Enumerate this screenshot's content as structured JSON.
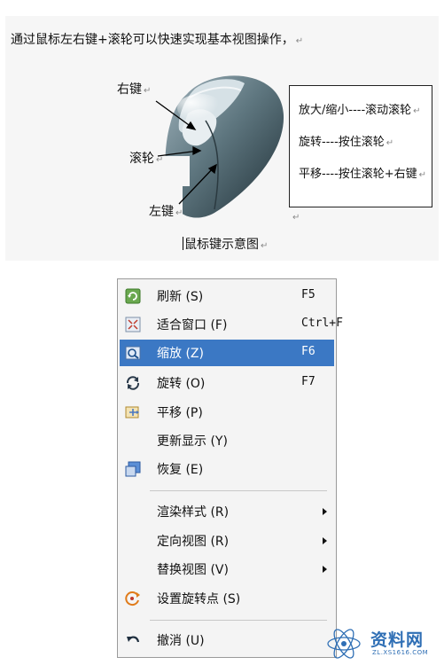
{
  "document": {
    "intro": "通过鼠标左右键+滚轮可以快速实现基本视图操作，",
    "para_mark": "↵",
    "labels": {
      "right": "右键",
      "wheel": "滚轮",
      "left": "左键"
    },
    "operations": [
      "放大/缩小----滚动滚轮",
      "旋转----按住滚轮",
      "平移----按住滚轮+右键"
    ],
    "caption": "鼠标键示意图"
  },
  "menu": {
    "items": [
      {
        "label": "刷新 (S)",
        "shortcut": "F5",
        "icon": "refresh-icon"
      },
      {
        "label": "适合窗口 (F)",
        "shortcut": "Ctrl+F",
        "icon": "fit-window-icon"
      },
      {
        "label": "缩放 (Z)",
        "shortcut": "F6",
        "icon": "zoom-icon",
        "selected": true
      },
      {
        "label": "旋转 (O)",
        "shortcut": "F7",
        "icon": "rotate-icon"
      },
      {
        "label": "平移 (P)",
        "shortcut": "",
        "icon": "pan-icon"
      },
      {
        "label": "更新显示 (Y)",
        "shortcut": "",
        "icon": ""
      },
      {
        "label": "恢复 (E)",
        "shortcut": "",
        "icon": "restore-icon"
      },
      {
        "label": "渲染样式 (R)",
        "submenu": true
      },
      {
        "label": "定向视图 (R)",
        "submenu": true
      },
      {
        "label": "替换视图 (V)",
        "submenu": true
      },
      {
        "label": "设置旋转点 (S)",
        "shortcut": "",
        "icon": "rotation-point-icon"
      },
      {
        "label": "撤消 (U)",
        "shortcut": "",
        "icon": "undo-icon"
      }
    ],
    "selected_color": "#3b78c4"
  },
  "watermark": {
    "text": "资料网",
    "url": "ZL.XS1616.COM"
  }
}
